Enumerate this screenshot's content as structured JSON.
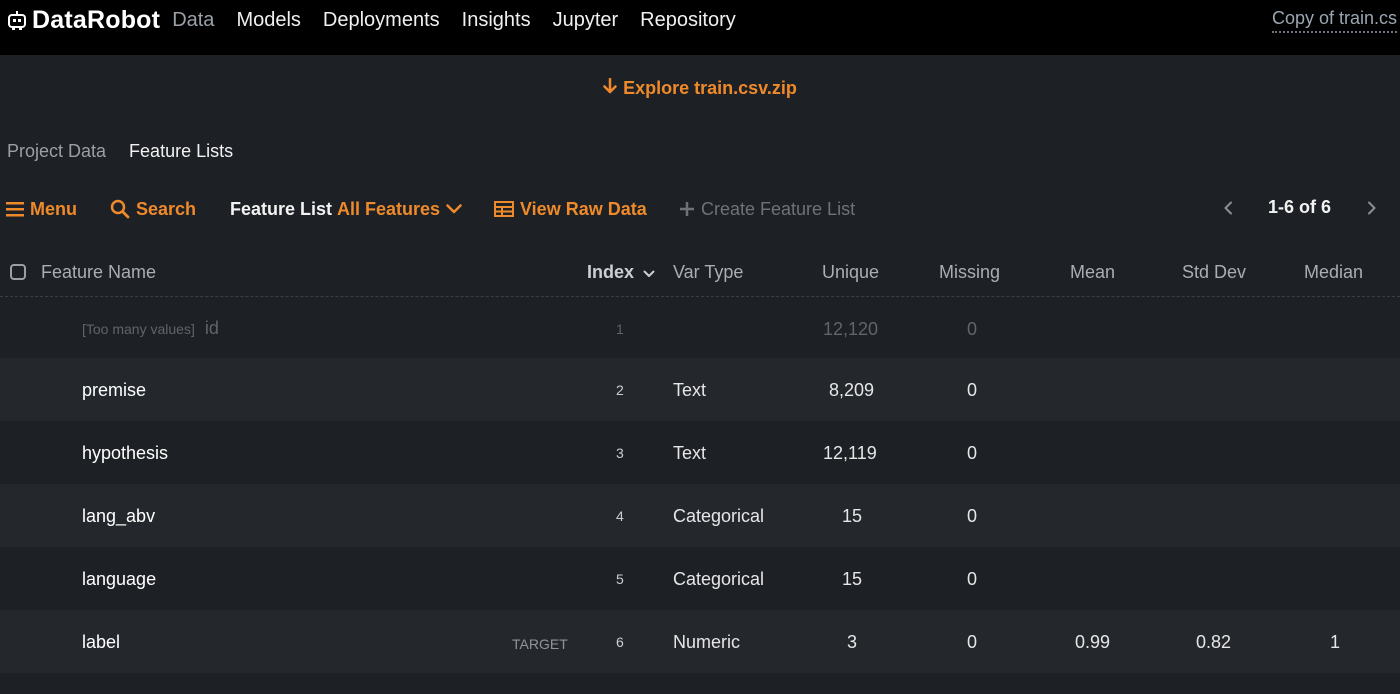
{
  "brand": {
    "name": "DataRobot",
    "icon": "robot-icon"
  },
  "nav": [
    {
      "label": "Data",
      "active": true
    },
    {
      "label": "Models",
      "active": false
    },
    {
      "label": "Deployments",
      "active": false
    },
    {
      "label": "Insights",
      "active": false
    },
    {
      "label": "Jupyter",
      "active": false
    },
    {
      "label": "Repository",
      "active": false
    }
  ],
  "project_name": "Copy of train.cs",
  "explore_label": "Explore train.csv.zip",
  "subtabs": [
    {
      "label": "Project Data",
      "active": false
    },
    {
      "label": "Feature Lists",
      "active": true
    }
  ],
  "toolbar": {
    "menu_label": "Menu",
    "search_label": "Search",
    "feature_list_label": "Feature List",
    "feature_list_value": "All Features",
    "view_raw_label": "View Raw Data",
    "create_list_label": "Create Feature List",
    "pager_text": "1-6 of 6"
  },
  "table": {
    "headers": {
      "name": "Feature Name",
      "index": "Index",
      "var_type": "Var Type",
      "unique": "Unique",
      "missing": "Missing",
      "mean": "Mean",
      "std": "Std Dev",
      "median": "Median"
    },
    "rows": [
      {
        "note": "[Too many values]",
        "name": "id",
        "tag": "",
        "index": "1",
        "var_type": "",
        "unique": "12,120",
        "missing": "0",
        "mean": "",
        "std": "",
        "median": ""
      },
      {
        "note": "",
        "name": "premise",
        "tag": "",
        "index": "2",
        "var_type": "Text",
        "unique": "8,209",
        "missing": "0",
        "mean": "",
        "std": "",
        "median": ""
      },
      {
        "note": "",
        "name": "hypothesis",
        "tag": "",
        "index": "3",
        "var_type": "Text",
        "unique": "12,119",
        "missing": "0",
        "mean": "",
        "std": "",
        "median": ""
      },
      {
        "note": "",
        "name": "lang_abv",
        "tag": "",
        "index": "4",
        "var_type": "Categorical",
        "unique": "15",
        "missing": "0",
        "mean": "",
        "std": "",
        "median": ""
      },
      {
        "note": "",
        "name": "language",
        "tag": "",
        "index": "5",
        "var_type": "Categorical",
        "unique": "15",
        "missing": "0",
        "mean": "",
        "std": "",
        "median": ""
      },
      {
        "note": "",
        "name": "label",
        "tag": "TARGET",
        "index": "6",
        "var_type": "Numeric",
        "unique": "3",
        "missing": "0",
        "mean": "0.99",
        "std": "0.82",
        "median": "1"
      }
    ]
  },
  "colors": {
    "accent": "#ef8a2b",
    "background": "#1d2024",
    "topbar": "#000000"
  }
}
